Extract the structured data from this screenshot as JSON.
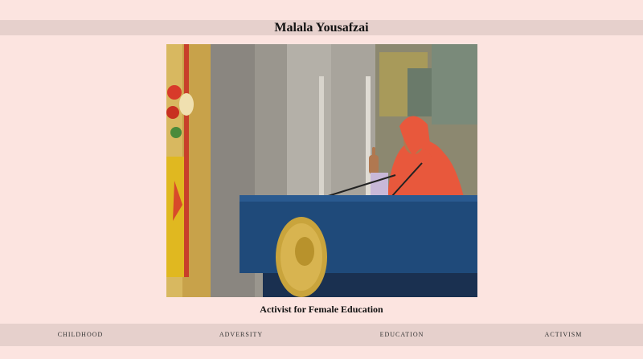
{
  "header": {
    "title": "Malala Yousafzai"
  },
  "hero": {
    "photo": "photo of Malala Yousafzai speaking at a blue podium with a gold medallion",
    "caption": "Activist for Female Education"
  },
  "nav": {
    "items": [
      {
        "label": "CHILDHOOD"
      },
      {
        "label": "ADVERSITY"
      },
      {
        "label": "EDUCATION"
      },
      {
        "label": "ACTIVISM"
      }
    ]
  },
  "colors": {
    "background": "#fce4e0",
    "bar": "#e6d0cc",
    "podium": "#1f4a7a",
    "scarf": "#e8583c",
    "medal": "#c9a43c"
  }
}
